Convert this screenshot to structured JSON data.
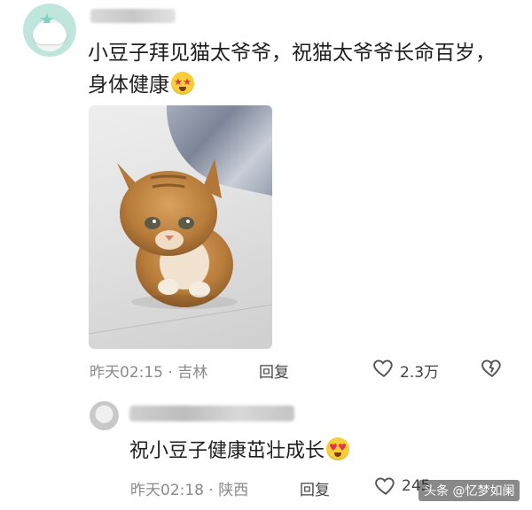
{
  "comment": {
    "text": "小豆子拜见猫太爷爷，祝猫太爷爷长命百岁，身体健康",
    "emoji": "star-struck-emoji",
    "time": "昨天02:15",
    "location": "吉林",
    "reply_label": "回复",
    "like_count": "2.3万"
  },
  "reply": {
    "text": "祝小豆子健康茁壮成长",
    "emoji": "heart-eyes-emoji",
    "time": "昨天02:18",
    "location": "陕西",
    "reply_label": "回复",
    "like_count": "245"
  },
  "watermark": "头条 @忆梦如阑",
  "separator": "·",
  "colors": {
    "meta": "#8a8a8a",
    "text": "#1f1f1f",
    "emoji": "#f8cf38"
  }
}
